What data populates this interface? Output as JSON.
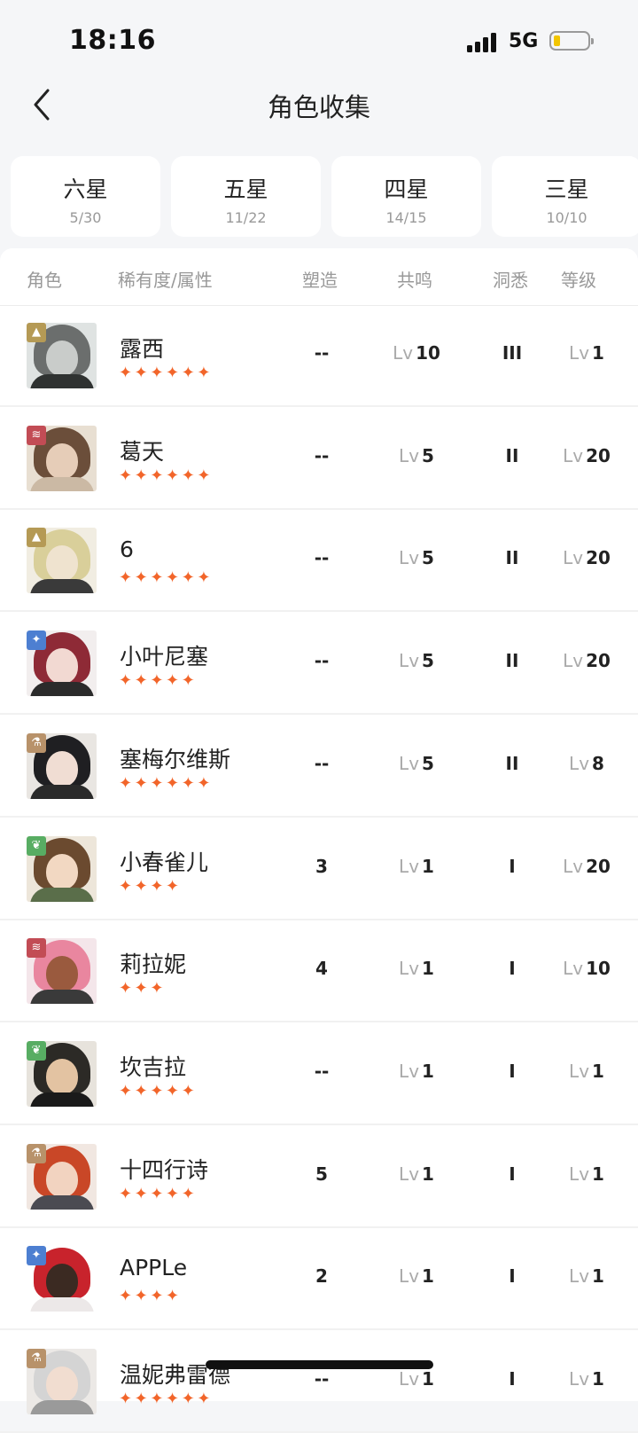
{
  "status_bar": {
    "time": "18:16",
    "network": "5G",
    "battery_level": 0.2
  },
  "header": {
    "title": "角色收集",
    "back_icon": "chevron-left-icon"
  },
  "tiers": [
    {
      "name": "六星",
      "count": "5/30"
    },
    {
      "name": "五星",
      "count": "11/22"
    },
    {
      "name": "四星",
      "count": "14/15"
    },
    {
      "name": "三星",
      "count": "10/10"
    }
  ],
  "table": {
    "columns": {
      "character": "角色",
      "rarity_attr": "稀有度/属性",
      "shape": "塑造",
      "resonance": "共鸣",
      "insight": "洞悉",
      "level": "等级"
    },
    "lv_prefix": "Lv",
    "rows": [
      {
        "name": "露西",
        "stars": "✦✦✦✦✦✦",
        "star_count": 6,
        "attr_icon": "pyramid-icon",
        "attr_color": "#b59a55",
        "attr_glyph": "▲",
        "shape": "--",
        "resonance": "10",
        "insight": "III",
        "level": "1",
        "palette": [
          "#dfe3e2",
          "#6b6e6d",
          "#c9ccca",
          "#2f3231"
        ]
      },
      {
        "name": "葛天",
        "stars": "✦✦✦✦✦✦",
        "star_count": 6,
        "attr_icon": "claw-icon",
        "attr_color": "#c24c55",
        "attr_glyph": "≋",
        "shape": "--",
        "resonance": "5",
        "insight": "II",
        "level": "20",
        "palette": [
          "#e8dfd2",
          "#6b4e3a",
          "#e6cdb8",
          "#cbb9a4"
        ]
      },
      {
        "name": "6",
        "stars": "✦✦✦✦✦✦",
        "star_count": 6,
        "attr_icon": "pyramid-icon",
        "attr_color": "#b59a55",
        "attr_glyph": "▲",
        "shape": "--",
        "resonance": "5",
        "insight": "II",
        "level": "20",
        "palette": [
          "#f1ede2",
          "#d9cf9a",
          "#efe3cf",
          "#3a3a3a"
        ]
      },
      {
        "name": "小叶尼塞",
        "stars": "✦✦✦✦✦",
        "star_count": 5,
        "attr_icon": "star-burst-icon",
        "attr_color": "#4d7fd1",
        "attr_glyph": "✦",
        "shape": "--",
        "resonance": "5",
        "insight": "II",
        "level": "20",
        "palette": [
          "#f2eeee",
          "#8e2a36",
          "#f2d9d2",
          "#2b2b2b"
        ]
      },
      {
        "name": "塞梅尔维斯",
        "stars": "✦✦✦✦✦✦",
        "star_count": 6,
        "attr_icon": "flask-icon",
        "attr_color": "#b8926a",
        "attr_glyph": "⚗",
        "shape": "--",
        "resonance": "5",
        "insight": "II",
        "level": "8",
        "palette": [
          "#e9e6e2",
          "#1f1f22",
          "#f0ddd3",
          "#2a2a2a"
        ]
      },
      {
        "name": "小春雀儿",
        "stars": "✦✦✦✦",
        "star_count": 4,
        "attr_icon": "leaf-icon",
        "attr_color": "#58ad63",
        "attr_glyph": "❦",
        "shape": "3",
        "resonance": "1",
        "insight": "I",
        "level": "20",
        "palette": [
          "#ede6da",
          "#6b4a2f",
          "#f2d8c2",
          "#5a6e4a"
        ]
      },
      {
        "name": "莉拉妮",
        "stars": "✦✦✦",
        "star_count": 3,
        "attr_icon": "claw-icon",
        "attr_color": "#c24c55",
        "attr_glyph": "≋",
        "shape": "4",
        "resonance": "1",
        "insight": "I",
        "level": "10",
        "palette": [
          "#f4e6ea",
          "#e9869f",
          "#9a5a3e",
          "#3a3a3a"
        ]
      },
      {
        "name": "坎吉拉",
        "stars": "✦✦✦✦✦",
        "star_count": 5,
        "attr_icon": "leaf-icon",
        "attr_color": "#58ad63",
        "attr_glyph": "❦",
        "shape": "--",
        "resonance": "1",
        "insight": "I",
        "level": "1",
        "palette": [
          "#e7e3dc",
          "#2c2a26",
          "#e3c3a2",
          "#1a1a1a"
        ]
      },
      {
        "name": "十四行诗",
        "stars": "✦✦✦✦✦",
        "star_count": 5,
        "attr_icon": "flask-icon",
        "attr_color": "#b8926a",
        "attr_glyph": "⚗",
        "shape": "5",
        "resonance": "1",
        "insight": "I",
        "level": "1",
        "palette": [
          "#f1e7e1",
          "#c94727",
          "#f2d3c0",
          "#4b4b52"
        ]
      },
      {
        "name": "APPLe",
        "stars": "✦✦✦✦",
        "star_count": 4,
        "attr_icon": "star-burst-icon",
        "attr_color": "#4d7fd1",
        "attr_glyph": "✦",
        "shape": "2",
        "resonance": "1",
        "insight": "I",
        "level": "1",
        "palette": [
          "#ffffff",
          "#c8232c",
          "#3b2a22",
          "#ece8e8"
        ]
      },
      {
        "name": "温妮弗雷德",
        "stars": "✦✦✦✦✦✦",
        "star_count": 6,
        "attr_icon": "flask-icon",
        "attr_color": "#b8926a",
        "attr_glyph": "⚗",
        "shape": "--",
        "resonance": "1",
        "insight": "I",
        "level": "1",
        "palette": [
          "#ece9e6",
          "#d4d4d4",
          "#f1ddd0",
          "#9a9a9a"
        ]
      }
    ]
  }
}
